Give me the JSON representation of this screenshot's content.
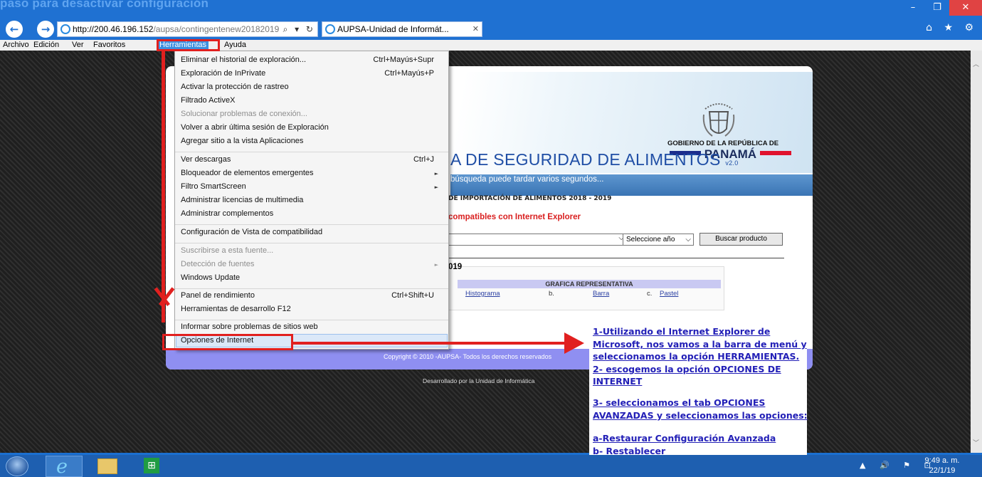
{
  "top_caption": "paso para desactivar configuración",
  "window_controls": {
    "minimize": "–",
    "restore": "❐",
    "close": "✕"
  },
  "nav": {
    "back": "←",
    "forward": "→",
    "address_host": "http://200.46.196.152",
    "address_path": "/aupsa/contingentenew20182019",
    "address_tools": "⌕ ▾ ↻",
    "tab_title": "AUPSA-Unidad de Informát...",
    "tab_close": "✕",
    "right_icons": "⌂ ★ ⚙"
  },
  "menubar": [
    "Archivo",
    "Edición",
    "Ver",
    "Favoritos",
    "Herramientas",
    "Ayuda"
  ],
  "active_menu": "Herramientas",
  "dropdown": {
    "items": [
      {
        "label": "Eliminar el historial de exploración...",
        "shortcut": "Ctrl+Mayús+Supr"
      },
      {
        "label": "Exploración de InPrivate",
        "shortcut": "Ctrl+Mayús+P"
      },
      {
        "label": "Activar la protección de rastreo"
      },
      {
        "label": "Filtrado ActiveX"
      },
      {
        "label": "Solucionar problemas de conexión...",
        "disabled": true
      },
      {
        "label": "Volver a abrir última sesión de Exploración"
      },
      {
        "label": "Agregar sitio a la vista Aplicaciones"
      },
      {
        "label": "Ver descargas",
        "shortcut": "Ctrl+J"
      },
      {
        "label": "Bloqueador de elementos emergentes",
        "submenu": true
      },
      {
        "label": "Filtro SmartScreen",
        "submenu": true
      },
      {
        "label": "Administrar licencias de multimedia"
      },
      {
        "label": "Administrar complementos"
      },
      {
        "label": "Configuración de Vista de compatibilidad"
      },
      {
        "label": "Suscribirse a esta fuente...",
        "disabled": true
      },
      {
        "label": "Detección de fuentes",
        "disabled": true,
        "submenu": true
      },
      {
        "label": "Windows Update"
      },
      {
        "label": "Panel de rendimiento",
        "shortcut": "Ctrl+Shift+U"
      },
      {
        "label": "Herramientas de desarrollo F12"
      },
      {
        "label": "Informar sobre problemas de sitios web"
      },
      {
        "label": "Opciones de Internet",
        "highlighted": true
      }
    ],
    "submenu_glyph": "►"
  },
  "web": {
    "gov_line": "GOBIERNO DE LA REPÚBLICA DE",
    "panama": "PANAMÁ",
    "title": "A DE SEGURIDAD DE ALIMENTOS",
    "title_version": "v2.0",
    "band_text": "búsqueda puede tardar varios segundos...",
    "subtitle": "DE IMPORTACIÓN DE ALIMENTOS  2018 - 2019",
    "compat": "compatibles con Internet Explorer",
    "year_placeholder": "Seleccione año",
    "caret": "⌵",
    "search_button": "Buscar producto",
    "year_label": "019",
    "graph_head": "GRAFICA REPRESENTATIVA",
    "graph_opt_a": "Histograma",
    "graph_opt_b_prefix": "b.",
    "graph_opt_b": "Barra",
    "graph_opt_c_prefix": "c.",
    "graph_opt_c": "Pastel",
    "copyright": "Copyright © 2010 -AUPSA- Todos los derechos reservados",
    "developed_by": "Desarrollado por la Unidad de Informática"
  },
  "instructions": [
    "1-Utilizando el Internet Explorer de",
    "Microsoft, nos vamos a la barra de menú y",
    "seleccionamos la opción HERRAMIENTAS.",
    "2- escogemos la opción OPCIONES DE",
    "INTERNET",
    "3- seleccionamos el tab OPCIONES",
    "AVANZADAS y seleccionamos las opciones:",
    "a-Restaurar Configuración Avanzada",
    "b- Restablecer"
  ],
  "taskbar": {
    "store_glyph": "⊞",
    "ie_glyph": "e",
    "tray": "▲ 🔊 ⚑ ⊡",
    "time": "9:49 a. m.",
    "date": "22/1/19"
  },
  "colors": {
    "accent_red": "#e1201f",
    "instruction_blue": "#2320b7",
    "ie_blue": "#1f71d2"
  }
}
